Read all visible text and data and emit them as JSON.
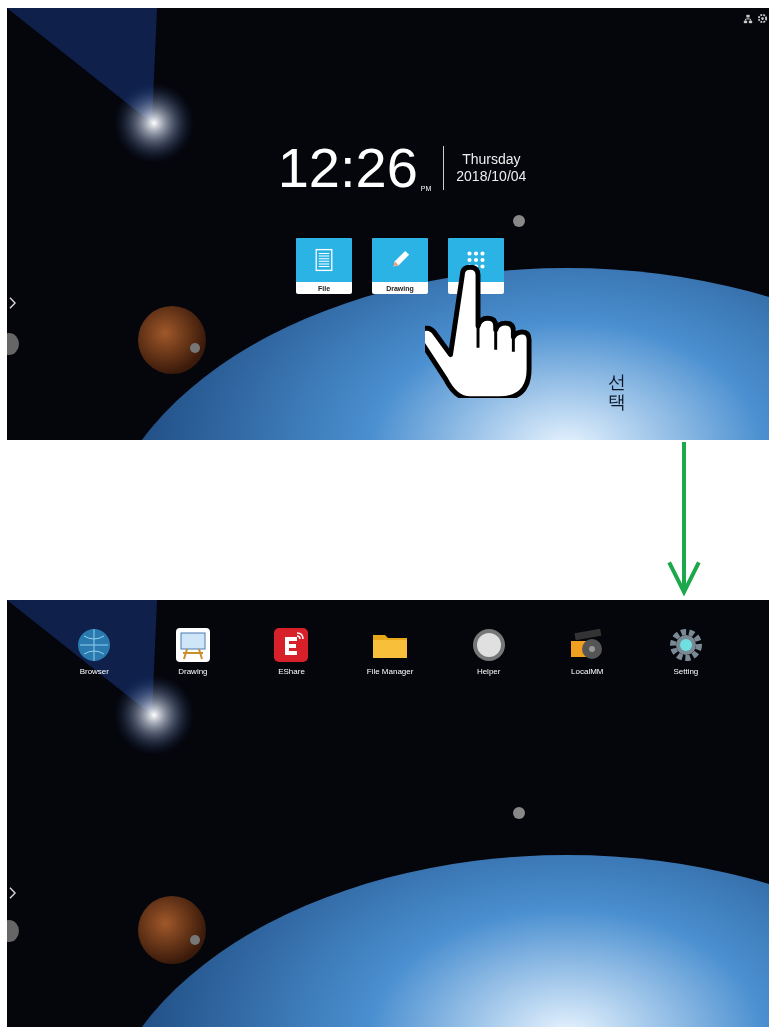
{
  "home_screen": {
    "time": "12:26",
    "meridiem": "PM",
    "day": "Thursday",
    "date": "2018/10/04",
    "tiles": [
      {
        "kind": "file",
        "label": "File"
      },
      {
        "kind": "drawing",
        "label": "Drawing"
      },
      {
        "kind": "apps"
      }
    ],
    "callout": "선택"
  },
  "app_drawer": {
    "apps": [
      {
        "kind": "globe",
        "label": "Browser"
      },
      {
        "kind": "easel",
        "label": "Drawing"
      },
      {
        "kind": "eshare",
        "label": "EShare"
      },
      {
        "kind": "folder",
        "label": "File Manager"
      },
      {
        "kind": "helper",
        "label": "Helper"
      },
      {
        "kind": "film",
        "label": "LocalMM"
      },
      {
        "kind": "gear",
        "label": "Setting"
      }
    ]
  }
}
